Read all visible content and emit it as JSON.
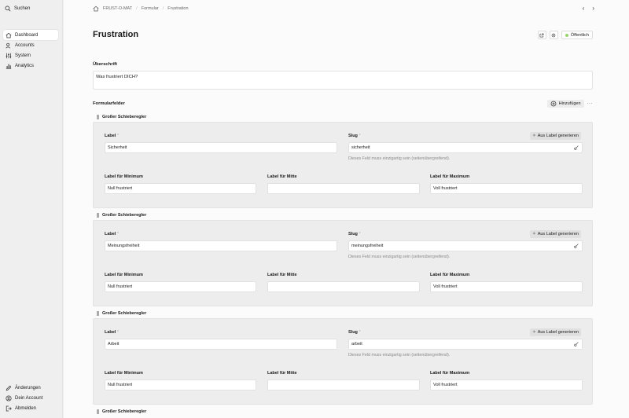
{
  "sidebar": {
    "search_label": "Suchen",
    "items": [
      {
        "label": "Dashboard",
        "icon": "home-icon"
      },
      {
        "label": "Accounts",
        "icon": "users-icon"
      },
      {
        "label": "System",
        "icon": "sliders-icon"
      },
      {
        "label": "Analytics",
        "icon": "bar-chart-icon"
      }
    ],
    "bottom": [
      {
        "label": "Änderungen",
        "icon": "pencil-icon"
      },
      {
        "label": "Dein Account",
        "icon": "user-circle-icon"
      },
      {
        "label": "Abmelden",
        "icon": "logout-icon"
      }
    ]
  },
  "breadcrumb": [
    "FRUST-O-MAT",
    "Formular",
    "Frustration"
  ],
  "page": {
    "title": "Frustration",
    "status": "Öffentlich",
    "status_color": "#9bd36b"
  },
  "headline": {
    "label": "Überschrift",
    "value": "Was frustriert DICH?"
  },
  "fields": {
    "label": "Formularfelder",
    "add_label": "Hinzufügen",
    "more": "···"
  },
  "blocks": [
    {
      "type": "Großer Schieberegler",
      "label_title": "Label",
      "label_value": "Sicherheit",
      "slug_title": "Slug",
      "slug_value": "sicherheit",
      "gen_label": "Aus Label generieren",
      "hint": "Dieses Feld muss einzigartig sein (seitenübergreifend).",
      "min_title": "Label für Minimum",
      "min_value": "Null frustriert",
      "mid_title": "Label für Mitte",
      "mid_value": "",
      "max_title": "Label für Maximum",
      "max_value": "Voll frustriert"
    },
    {
      "type": "Großer Schieberegler",
      "label_title": "Label",
      "label_value": "Meinungsfreiheit",
      "slug_title": "Slug",
      "slug_value": "meinungsfreiheit",
      "gen_label": "Aus Label generieren",
      "hint": "Dieses Feld muss einzigartig sein (seitenübergreifend).",
      "min_title": "Label für Minimum",
      "min_value": "Null frustriert",
      "mid_title": "Label für Mitte",
      "mid_value": "",
      "max_title": "Label für Maximum",
      "max_value": "Voll frustriert"
    },
    {
      "type": "Großer Schieberegler",
      "label_title": "Label",
      "label_value": "Arbeit",
      "slug_title": "Slug",
      "slug_value": "arbeit",
      "gen_label": "Aus Label generieren",
      "hint": "Dieses Feld muss einzigartig sein (seitenübergreifend).",
      "min_title": "Label für Minimum",
      "min_value": "Null frustriert",
      "mid_title": "Label für Mitte",
      "mid_value": "",
      "max_title": "Label für Maximum",
      "max_value": "Voll frustriert"
    },
    {
      "type": "Großer Schieberegler"
    }
  ]
}
